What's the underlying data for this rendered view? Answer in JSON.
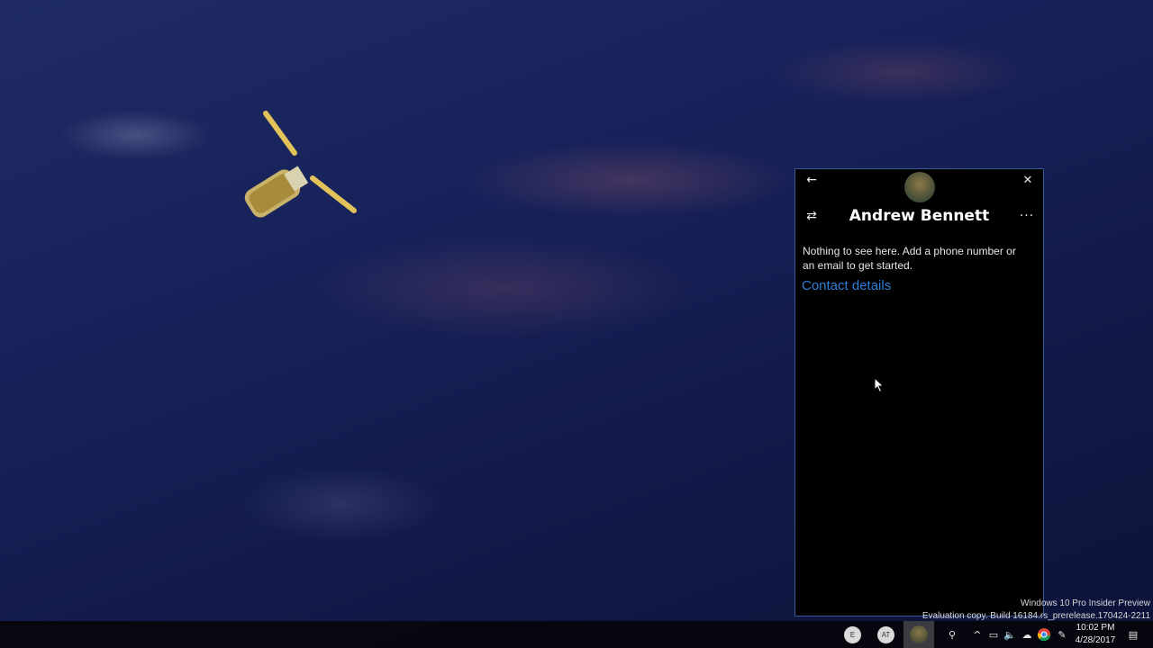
{
  "contact_card": {
    "name": "Andrew Bennett",
    "back_icon": "←",
    "close_icon": "✕",
    "switch_icon": "⇄",
    "more_icon": "···",
    "empty_message": "Nothing to see here. Add a phone number or an email to get started.",
    "contact_details_link": "Contact details"
  },
  "watermark": {
    "line1": "Windows 10 Pro Insider Preview",
    "line2": "Evaluation copy. Build 16184.rs_prerelease.170424-2211"
  },
  "taskbar": {
    "people": [
      {
        "initials": "E"
      },
      {
        "initials": "AT"
      }
    ],
    "tray_icons": {
      "people": "⚲",
      "chevron": "^",
      "network": "▭",
      "volume": "🔈",
      "onedrive": "☁",
      "pen": "✎",
      "notifications": "▤"
    },
    "clock": {
      "time": "10:02 PM",
      "date": "4/28/2017"
    }
  },
  "colors": {
    "accent_link": "#2f7fd6",
    "panel_border": "#3a5a9a"
  }
}
